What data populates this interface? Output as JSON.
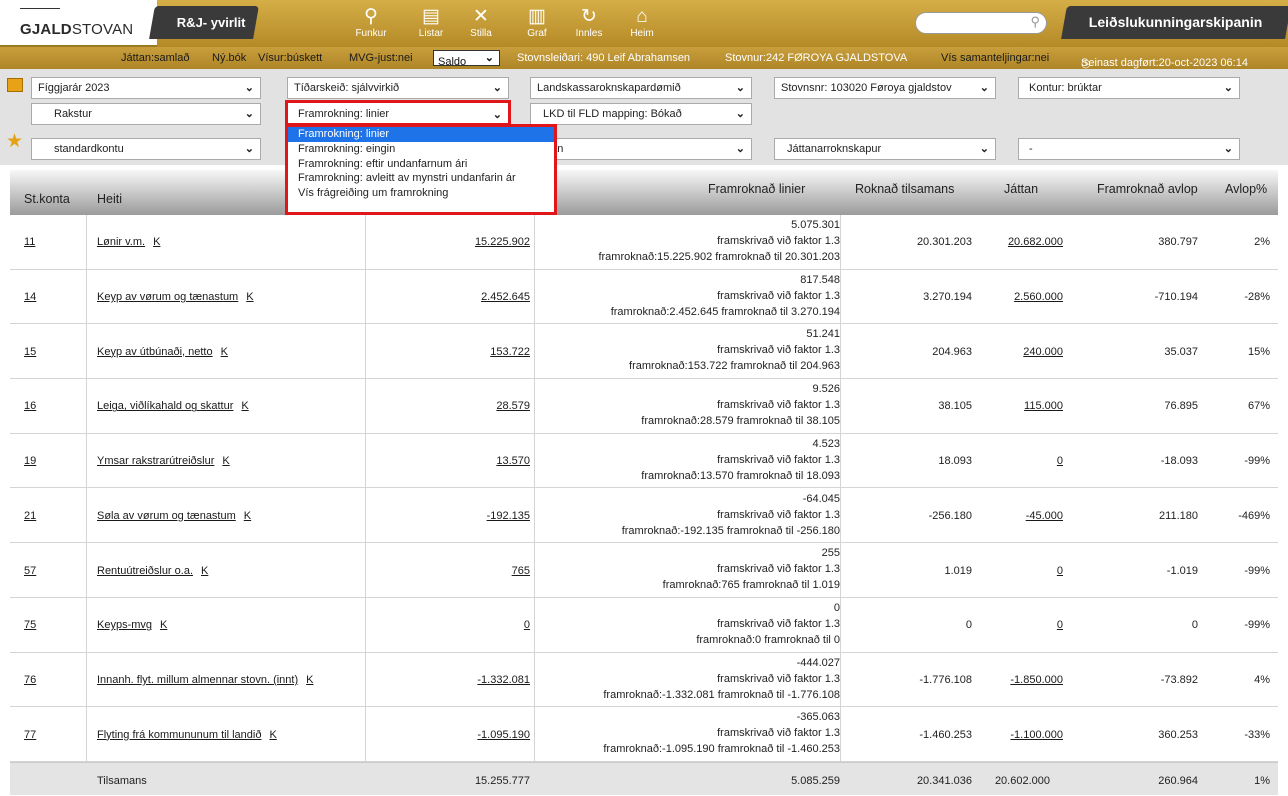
{
  "brand": {
    "logo_bold": "GJALD",
    "logo_rest": "STOVAN"
  },
  "unit_tab": "R&J- yvirlit",
  "nav": [
    {
      "label": "Funkur",
      "icon": "search-icon",
      "glyph": "⚲"
    },
    {
      "label": "Listar",
      "icon": "document-icon",
      "glyph": "▤"
    },
    {
      "label": "Stilla",
      "icon": "tools-icon",
      "glyph": "✕"
    },
    {
      "label": "Graf",
      "icon": "bar-chart-icon",
      "glyph": "▥"
    },
    {
      "label": "Innles",
      "icon": "refresh-icon",
      "glyph": "↻"
    },
    {
      "label": "Heim",
      "icon": "home-icon",
      "glyph": "⌂"
    }
  ],
  "search": {
    "placeholder": ""
  },
  "org_tab": "Leiðslukunningarskipanin",
  "info": {
    "jattan": "Játtan:samlað",
    "nybok": "Ný.bók",
    "visur": "Vísur:búskett",
    "mvg": "MVG-just:nei",
    "saldo": "Saldo",
    "stovnsleidari": "Stovnsleiðari: 490 Leif Abrahamsen",
    "stovnur": "Stovnur:242 FØROYA GJALDSTOVA",
    "samanteljingar": "Vís samanteljingar:nei",
    "dagfort": "Seinast dagført:20-oct-2023 06:14"
  },
  "filters": {
    "row1": [
      "Fíggjarár 2023",
      "Tíðarskeið: sjálvvirkið",
      "Landskassaroknskapardømið",
      "Stovnsnr: 103020 Føroya gjaldstov",
      "Kontur: brúktar"
    ],
    "row2": [
      "Rakstur",
      "Framrokning: linier",
      "LKD til FLD mapping: Bókað"
    ],
    "row3": [
      "standardkontu",
      "ttan",
      "Játtanarroknskapur",
      "-"
    ]
  },
  "dropdown": [
    "Framrokning: linier",
    "Framrokning: eingin",
    "Framrokning: eftir undanfarnum ári",
    "Framrokning: avleitt av mynstri undanfarin ár",
    "Vís frágreiðing um framrokning"
  ],
  "table": {
    "headers": {
      "stkonta": "St.konta",
      "heiti": "Heiti",
      "framroknad": "Framroknað linier",
      "roknad": "Roknað tilsamans",
      "jattan": "Játtan",
      "avlop": "Framroknað avlop",
      "avlop_pct": "Avlop%"
    },
    "rows": [
      {
        "konta": "11",
        "heiti": "Lønir v.m.",
        "k": "K",
        "value": "15.225.902",
        "f1": "5.075.301",
        "f2": "framskrivað við faktor 1.3",
        "f3": "framroknað:15.225.902 framroknað til 20.301.203",
        "roknad": "20.301.203",
        "jattan": "20.682.000",
        "avlop": "380.797",
        "pct": "2%"
      },
      {
        "konta": "14",
        "heiti": "Keyp av vørum og tænastum",
        "k": "K",
        "value": "2.452.645",
        "f1": "817.548",
        "f2": "framskrivað við faktor 1.3",
        "f3": "framroknað:2.452.645 framroknað til 3.270.194",
        "roknad": "3.270.194",
        "jattan": "2.560.000",
        "avlop": "-710.194",
        "pct": "-28%"
      },
      {
        "konta": "15",
        "heiti": "Keyp av útbúnaði, netto",
        "k": "K",
        "value": "153.722",
        "f1": "51.241",
        "f2": "framskrivað við faktor 1.3",
        "f3": "framroknað:153.722 framroknað til 204.963",
        "roknad": "204.963",
        "jattan": "240.000",
        "avlop": "35.037",
        "pct": "15%"
      },
      {
        "konta": "16",
        "heiti": "Leiga, viðlíkahald og skattur",
        "k": "K",
        "value": "28.579",
        "f1": "9.526",
        "f2": "framskrivað við faktor 1.3",
        "f3": "framroknað:28.579 framroknað til 38.105",
        "roknad": "38.105",
        "jattan": "115.000",
        "avlop": "76.895",
        "pct": "67%"
      },
      {
        "konta": "19",
        "heiti": "Ymsar rakstrarútreiðslur",
        "k": "K",
        "value": "13.570",
        "f1": "4.523",
        "f2": "framskrivað við faktor 1.3",
        "f3": "framroknað:13.570 framroknað til 18.093",
        "roknad": "18.093",
        "jattan": "0",
        "avlop": "-18.093",
        "pct": "-99%"
      },
      {
        "konta": "21",
        "heiti": "Søla av vørum og tænastum",
        "k": "K",
        "value": "-192.135",
        "f1": "-64.045",
        "f2": "framskrivað við faktor 1.3",
        "f3": "framroknað:-192.135 framroknað til -256.180",
        "roknad": "-256.180",
        "jattan": "-45.000",
        "avlop": "211.180",
        "pct": "-469%"
      },
      {
        "konta": "57",
        "heiti": "Rentuútreiðslur o.a.",
        "k": "K",
        "value": "765",
        "f1": "255",
        "f2": "framskrivað við faktor 1.3",
        "f3": "framroknað:765 framroknað til 1.019",
        "roknad": "1.019",
        "jattan": "0",
        "avlop": "-1.019",
        "pct": "-99%"
      },
      {
        "konta": "75",
        "heiti": "Keyps-mvg",
        "k": "K",
        "value": "0",
        "f1": "0",
        "f2": "framskrivað við faktor 1.3",
        "f3": "framroknað:0 framroknað til 0",
        "roknad": "0",
        "jattan": "0",
        "avlop": "0",
        "pct": "-99%"
      },
      {
        "konta": "76",
        "heiti": "Innanh. flyt. millum almennar stovn. (innt)",
        "k": "K",
        "value": "-1.332.081",
        "f1": "-444.027",
        "f2": "framskrivað við faktor 1.3",
        "f3": "framroknað:-1.332.081 framroknað til -1.776.108",
        "roknad": "-1.776.108",
        "jattan": "-1.850.000",
        "avlop": "-73.892",
        "pct": "4%"
      },
      {
        "konta": "77",
        "heiti": "Flyting frá kommununum til landið",
        "k": "K",
        "value": "-1.095.190",
        "f1": "-365.063",
        "f2": "framskrivað við faktor 1.3",
        "f3": "framroknað:-1.095.190 framroknað til -1.460.253",
        "roknad": "-1.460.253",
        "jattan": "-1.100.000",
        "avlop": "360.253",
        "pct": "-33%"
      }
    ],
    "footer": {
      "label": "Tilsamans",
      "value": "15.255.777",
      "framroknad": "5.085.259",
      "roknad": "20.341.036",
      "jattan": "20.602.000",
      "avlop": "260.964",
      "pct": "1%"
    }
  }
}
